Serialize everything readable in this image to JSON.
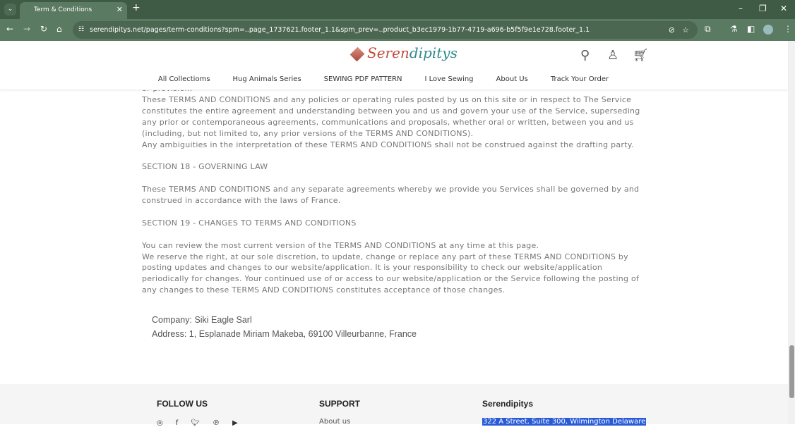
{
  "browser": {
    "tab_title": "Term & Conditions",
    "url": "serendipitys.net/pages/term-conditions?spm=..page_1737621.footer_1.1&spm_prev=..product_b3ec1979-1b77-4719-a696-b5f5f9e1e728.footer_1.1"
  },
  "header": {
    "logo": "Seren",
    "logo_tail": "dipitys",
    "nav": [
      "All Collectioms",
      "Hug Animals Series",
      "SEWING PDF PATTERN",
      "I Love Sewing",
      "About Us",
      "Track Your Order"
    ]
  },
  "content": {
    "cut_line": "or provision.",
    "p1": "These TERMS AND CONDITIONS and any policies or operating rules posted by us on this site or in respect to The Service constitutes the entire agreement and understanding between you and us and govern your use of the Service, superseding any prior or contemporaneous agreements, communications and proposals, whether oral or written, between you and us (including, but not limited to, any prior versions of the TERMS AND CONDITIONS).",
    "p2": "Any ambiguities in the interpretation of these TERMS AND CONDITIONS shall not be construed against the drafting party.",
    "s18": "SECTION 18 - GOVERNING LAW",
    "p3": "These TERMS AND CONDITIONS and any separate agreements whereby we provide you Services shall be governed by and construed in accordance with the laws of France.",
    "s19": "SECTION 19 - CHANGES TO TERMS AND CONDITIONS",
    "p4": "You can review the most current version of the TERMS AND CONDITIONS at any time at this page.",
    "p5": "We reserve the right, at our sole discretion, to update, change or replace any part of these TERMS AND CONDITIONS by posting updates and changes to our website/application. It is your responsibility to check our website/application periodically for changes. Your continued use of or access to our website/application or the Service following the posting of any changes to these TERMS AND CONDITIONS constitutes acceptance of those changes.",
    "company": "Company: Siki Eagle Sarl",
    "address": "Address: 1, Esplanade Miriam Makeba, 69100 Villeurbanne, France"
  },
  "footer": {
    "follow": "FOLLOW US",
    "support": "SUPPORT",
    "support_link": "About us",
    "brand": "Serendipitys",
    "brand_address": "322 A Street, Suite 300, Wilmington Delaware"
  }
}
